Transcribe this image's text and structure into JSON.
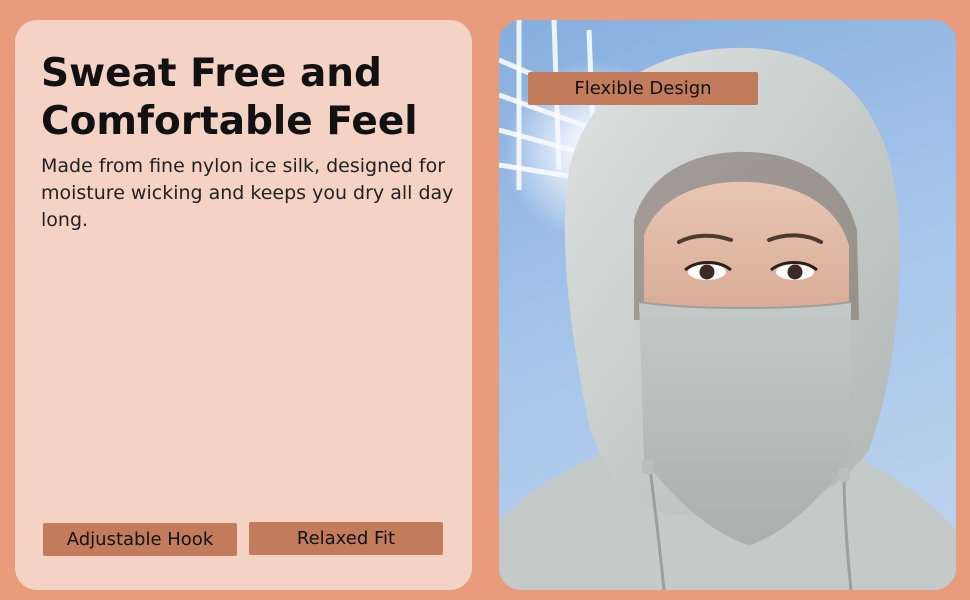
{
  "headline": {
    "line1": "Sweat Free and",
    "line2": "Comfortable Feel"
  },
  "description": "Made from fine nylon ice silk, designed for moisture wicking and keeps you dry all day long.",
  "feature_tags": {
    "adjustable_hook": "Adjustable Hook",
    "relaxed_fit": "Relaxed Fit",
    "flexible_design": "Flexible Design"
  },
  "colors": {
    "background": "#e89c7b",
    "text_panel": "#f4d3c5",
    "tag": "#c27c5b",
    "sky": "#a4c4ea",
    "garment": "#c9cfcd"
  },
  "photo": {
    "icon": "model-in-sun-protection-hoodie-image"
  }
}
